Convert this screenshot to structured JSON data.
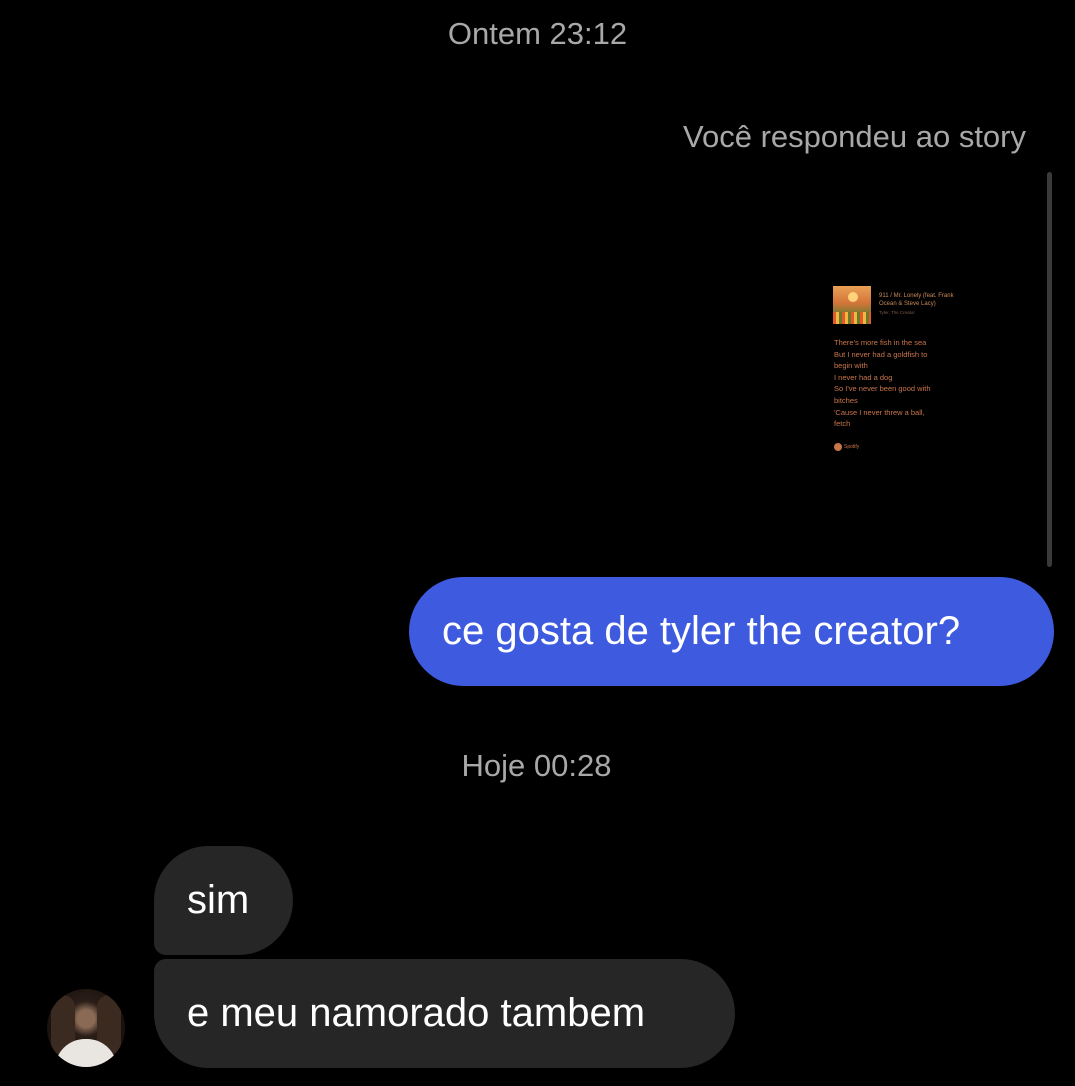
{
  "thread": {
    "timestamp_1": "Ontem 23:12",
    "timestamp_2": "Hoje 00:28"
  },
  "story_reply": {
    "label": "Você respondeu ao story",
    "card": {
      "song_title": "911 / Mr. Lonely (feat. Frank Ocean & Steve Lacy)",
      "artist": "Tyler, The Creator",
      "lyrics": "There's more fish in the sea\nBut I never had a goldfish to\nbegin with\nI never had a dog\nSo I've never been good with\nbitches\n'Cause I never threw a ball,\nfetch",
      "brand": "Spotify",
      "accent_color": "#c9754a"
    }
  },
  "messages": {
    "outgoing_1": "ce gosta de tyler the creator?",
    "incoming_1": "sim",
    "incoming_2": "e meu namorado tambem"
  },
  "colors": {
    "background": "#000000",
    "outgoing_bubble": "#3e5be0",
    "incoming_bubble": "#262626",
    "meta_text": "#a8a8a8"
  }
}
